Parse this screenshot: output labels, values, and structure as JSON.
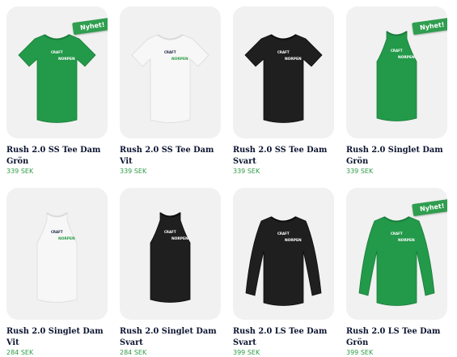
{
  "colors": {
    "price": "#2e9c46",
    "badge": "#2f9e4f",
    "title": "#0c1430",
    "card_bg": "#f1f1f1"
  },
  "products": [
    {
      "name": "Rush 2.0 SS Tee Dam Grön",
      "price": "339 SEK",
      "badge": "Nyhet!",
      "garment": "tee",
      "color": "green"
    },
    {
      "name": "Rush 2.0 SS Tee Dam Vit",
      "price": "339 SEK",
      "badge": "",
      "garment": "tee",
      "color": "white"
    },
    {
      "name": "Rush 2.0 SS Tee Dam Svart",
      "price": "339 SEK",
      "badge": "",
      "garment": "tee",
      "color": "black"
    },
    {
      "name": "Rush 2.0 Singlet Dam Grön",
      "price": "339 SEK",
      "badge": "Nyhet!",
      "garment": "singlet",
      "color": "green"
    },
    {
      "name": "Rush 2.0 Singlet Dam Vit",
      "price": "284 SEK",
      "badge": "",
      "garment": "singlet",
      "color": "white"
    },
    {
      "name": "Rush 2.0 Singlet Dam Svart",
      "price": "284 SEK",
      "badge": "",
      "garment": "singlet",
      "color": "black"
    },
    {
      "name": "Rush 2.0 LS Tee Dam Svart",
      "price": "399 SEK",
      "badge": "",
      "garment": "ls",
      "color": "black"
    },
    {
      "name": "Rush 2.0 LS Tee Dam Grön",
      "price": "399 SEK",
      "badge": "Nyhet!",
      "garment": "ls",
      "color": "green"
    }
  ],
  "logo_text": {
    "brand": "CRAFT",
    "print": "NORPEN"
  }
}
